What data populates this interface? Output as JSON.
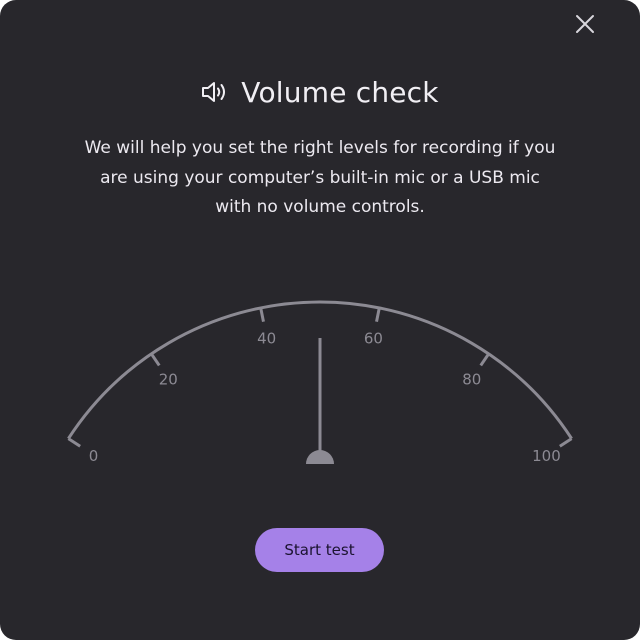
{
  "dialog": {
    "title": "Volume check",
    "description": "We will help you set the right levels for recording if you are using your computer’s built-in mic or a USB mic with no volume controls.",
    "close_icon": "close-icon",
    "title_icon": "speaker-icon"
  },
  "meter": {
    "scale_min": 0,
    "scale_max": 100,
    "tick_labels": [
      "0",
      "20",
      "40",
      "60",
      "80",
      "100"
    ],
    "needle_value": 50
  },
  "actions": {
    "start_label": "Start test"
  },
  "colors": {
    "background": "#28272c",
    "text": "#f1eff4",
    "gauge": "#8c8a93",
    "accent": "#a581e8"
  }
}
